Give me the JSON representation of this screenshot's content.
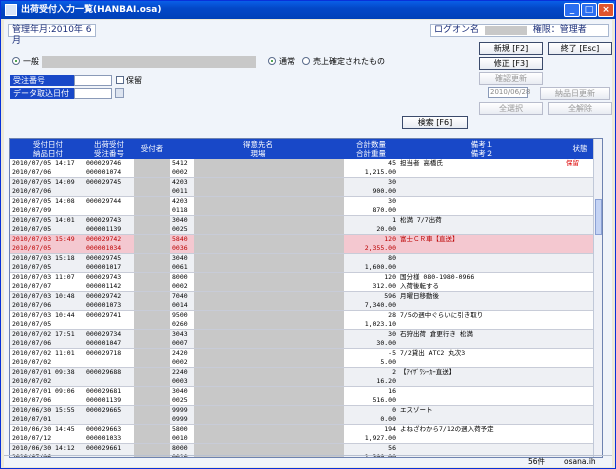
{
  "window": {
    "title": "出荷受付入力一覧(HANBAI.osa)"
  },
  "header": {
    "period": "管理年月:2010年 6月",
    "login_label": "ログオン名",
    "auth_label": "権限：管理者"
  },
  "filters": {
    "general": "一般",
    "normal": "通常",
    "sales_confirmed": "売上確定されたもの",
    "order_no": "受注番号",
    "hold": "保留",
    "data_date": "データ取込日付",
    "date_value": "2010/06/28"
  },
  "toolbar": {
    "new": "新規 [F2]",
    "exit": "終了 [Esc]",
    "edit": "修正 [F3]",
    "confirm_update": "確認更新",
    "search": "検索 [F6]",
    "delivery_update": "納品日更新",
    "select_all": "全選択",
    "deselect_all": "全解除"
  },
  "grid": {
    "headers": {
      "date1": "受付日付",
      "date2": "納品日付",
      "no1": "出荷受付",
      "no2": "受注番号",
      "staff": "受付者",
      "dest1": "得意先名",
      "dest2": "現場",
      "qty1": "合計数量",
      "qty2": "合計重量",
      "memo1": "備考１",
      "memo2": "備考２",
      "state": "状態"
    },
    "rows": [
      {
        "d1": "2010/07/05 14:17",
        "d2": "2010/07/06",
        "n1": "000029746",
        "n2": "000001074",
        "c1": "5412",
        "c2": "0002",
        "q1": "45",
        "q2": "1,215.00",
        "m1": "担当者 高橋氏",
        "m2": "",
        "st": "保留"
      },
      {
        "d1": "2010/07/05 14:09",
        "d2": "2010/07/06",
        "n1": "000029745",
        "n2": "",
        "c1": "4203",
        "c2": "0011",
        "q1": "30",
        "q2": "900.00",
        "m1": "",
        "m2": "",
        "st": ""
      },
      {
        "d1": "2010/07/05 14:08",
        "d2": "2010/07/09",
        "n1": "000029744",
        "n2": "",
        "c1": "4203",
        "c2": "0118",
        "q1": "30",
        "q2": "870.00",
        "m1": "",
        "m2": "",
        "st": ""
      },
      {
        "d1": "2010/07/05 14:01",
        "d2": "2010/07/05",
        "n1": "000029743",
        "n2": "000001139",
        "c1": "3040",
        "c2": "0025",
        "q1": "1",
        "q2": "20.00",
        "m1": "松満 7/7出荷",
        "m2": "",
        "st": ""
      },
      {
        "d1": "2010/07/03 15:49",
        "d2": "2010/07/05",
        "n1": "000029742",
        "n2": "000001034",
        "c1": "5840",
        "c2": "0036",
        "q1": "120",
        "q2": "2,355.00",
        "m1": "富士ＣＲ車【直送】",
        "m2": "",
        "st": ""
      },
      {
        "d1": "2010/07/03 15:18",
        "d2": "2010/07/05",
        "n1": "000029745",
        "n2": "000001017",
        "c1": "3040",
        "c2": "0061",
        "q1": "80",
        "q2": "1,600.00",
        "m1": "",
        "m2": "",
        "st": ""
      },
      {
        "d1": "2010/07/03 11:07",
        "d2": "2010/07/07",
        "n1": "000029743",
        "n2": "000001142",
        "c1": "8000",
        "c2": "0002",
        "q1": "120",
        "q2": "312.00",
        "m1": "国分様 080-1980-0966",
        "m2": "入荷後転する",
        "st": ""
      },
      {
        "d1": "2010/07/03 10:48",
        "d2": "2010/07/06",
        "n1": "000029742",
        "n2": "000001073",
        "c1": "7040",
        "c2": "0014",
        "q1": "596",
        "q2": "7,340.00",
        "m1": "月曜日移動後",
        "m2": "",
        "st": ""
      },
      {
        "d1": "2010/07/03 10:44",
        "d2": "2010/07/05",
        "n1": "000029741",
        "n2": "",
        "c1": "9500",
        "c2": "0260",
        "q1": "28",
        "q2": "1,023.10",
        "m1": "7/5の週中ぐらいに引き取り",
        "m2": "",
        "st": ""
      },
      {
        "d1": "2010/07/02 17:51",
        "d2": "2010/07/06",
        "n1": "000029734",
        "n2": "000001047",
        "c1": "3043",
        "c2": "0007",
        "q1": "30",
        "q2": "30.00",
        "m1": "石狩出荷 倉更行き 松満",
        "m2": "",
        "st": ""
      },
      {
        "d1": "2010/07/02 11:01",
        "d2": "2010/07/02",
        "n1": "000029718",
        "n2": "",
        "c1": "2420",
        "c2": "0002",
        "q1": "-5",
        "q2": "5.00",
        "m1": "7/2貸出 ATC2 丸次3",
        "m2": "",
        "st": ""
      },
      {
        "d1": "2010/07/01 09:38",
        "d2": "2010/07/02",
        "n1": "000029688",
        "n2": "",
        "c1": "2240",
        "c2": "0003",
        "q1": "2",
        "q2": "16.20",
        "m1": "【ｱｲｻﾞﾜｼｰｶｰ直送】",
        "m2": "",
        "st": ""
      },
      {
        "d1": "2010/07/01 09:06",
        "d2": "2010/07/06",
        "n1": "000029681",
        "n2": "000001139",
        "c1": "3040",
        "c2": "0025",
        "q1": "16",
        "q2": "516.00",
        "m1": "",
        "m2": "",
        "st": ""
      },
      {
        "d1": "2010/06/30 15:55",
        "d2": "2010/07/01",
        "n1": "000029665",
        "n2": "",
        "c1": "9999",
        "c2": "0999",
        "q1": "0",
        "q2": "0.00",
        "m1": "エスゾート",
        "m2": "",
        "st": ""
      },
      {
        "d1": "2010/06/30 14:45",
        "d2": "2010/07/12",
        "n1": "000029663",
        "n2": "000001033",
        "c1": "5800",
        "c2": "0010",
        "q1": "194",
        "q2": "1,927.00",
        "m1": "よねざわから7/12の週入荷予定",
        "m2": "",
        "st": ""
      },
      {
        "d1": "2010/06/30 14:12",
        "d2": "2010/07/06",
        "n1": "000029661",
        "n2": "",
        "c1": "8000",
        "c2": "0010",
        "q1": "56",
        "q2": "1,300.00",
        "m1": "",
        "m2": "",
        "st": ""
      }
    ]
  },
  "status": {
    "count": "56件",
    "user": "osana.ih"
  }
}
